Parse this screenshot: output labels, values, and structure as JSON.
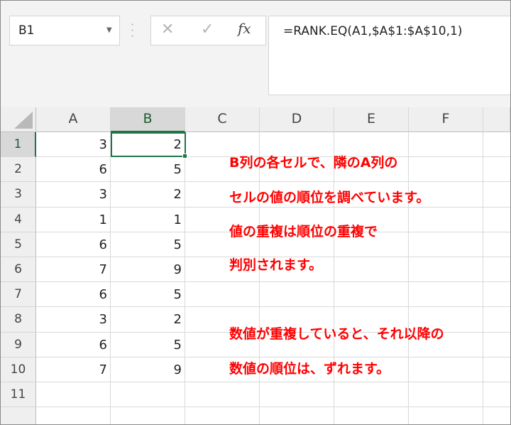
{
  "name_box": {
    "value": "B1"
  },
  "formula_bar": {
    "cancel_glyph": "✕",
    "enter_glyph": "✓",
    "fx_label": "fx",
    "formula": "=RANK.EQ(A1,$A$1:$A$10,1)"
  },
  "columns": [
    "A",
    "B",
    "C",
    "D",
    "E",
    "F"
  ],
  "selected": {
    "column": "B",
    "row": 1,
    "accent_color": "#217346"
  },
  "rows": [
    {
      "row": "1",
      "a": "3",
      "b": "2"
    },
    {
      "row": "2",
      "a": "6",
      "b": "5"
    },
    {
      "row": "3",
      "a": "3",
      "b": "2"
    },
    {
      "row": "4",
      "a": "1",
      "b": "1"
    },
    {
      "row": "5",
      "a": "6",
      "b": "5"
    },
    {
      "row": "6",
      "a": "7",
      "b": "9"
    },
    {
      "row": "7",
      "a": "6",
      "b": "5"
    },
    {
      "row": "8",
      "a": "3",
      "b": "2"
    },
    {
      "row": "9",
      "a": "6",
      "b": "5"
    },
    {
      "row": "10",
      "a": "7",
      "b": "9"
    },
    {
      "row": "11",
      "a": "",
      "b": ""
    }
  ],
  "notes": {
    "color": "#ff0000",
    "lines": [
      "B列の各セルで、隣のA列の",
      "セルの値の順位を調べています。",
      "値の重複は順位の重複で",
      "判別されます。",
      "数値が重複していると、それ以降の",
      "数値の順位は、ずれます。"
    ]
  }
}
